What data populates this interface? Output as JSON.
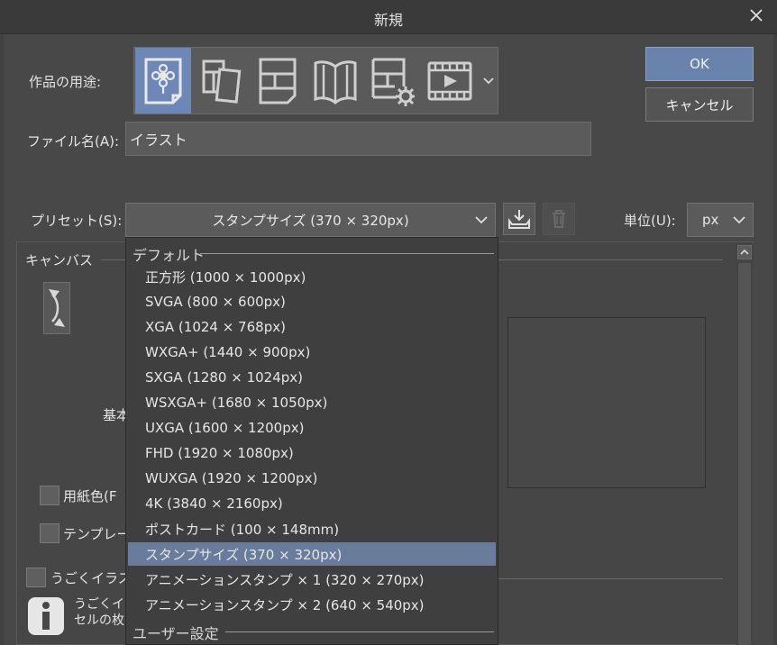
{
  "window": {
    "title": "新規"
  },
  "buttons": {
    "ok": "OK",
    "cancel": "キャンセル"
  },
  "usage": {
    "label": "作品の用途:",
    "options": [
      {
        "icon": "illustration-icon",
        "selected": true
      },
      {
        "icon": "comic-icon",
        "selected": false
      },
      {
        "icon": "comic-page-icon",
        "selected": false
      },
      {
        "icon": "book-icon",
        "selected": false
      },
      {
        "icon": "page-settings-icon",
        "selected": false
      },
      {
        "icon": "animation-icon",
        "selected": false
      }
    ]
  },
  "filename": {
    "label": "ファイル名(A):",
    "value": "イラスト"
  },
  "preset": {
    "label": "プリセット(S):",
    "value": "スタンプサイズ (370 × 320px)"
  },
  "unit": {
    "label": "単位(U):",
    "value": "px"
  },
  "canvas": {
    "section_label": "キャンバス",
    "base_label_partial": "基本",
    "paper_color_partial": "用紙色(F",
    "template_partial": "テンプレー",
    "animated_partial": "うごくイラスト",
    "info_line1_partial": "うごくイラ",
    "info_line2_partial": "セルの枚"
  },
  "dropdown": {
    "group_default": "デフォルト",
    "group_user": "ユーザー設定",
    "selected_index": 11,
    "items": [
      "正方形 (1000 × 1000px)",
      "SVGA (800 × 600px)",
      "XGA (1024 × 768px)",
      "WXGA+ (1440 × 900px)",
      "SXGA (1280 × 1024px)",
      "WSXGA+ (1680 × 1050px)",
      "UXGA (1600 × 1200px)",
      "FHD (1920 × 1080px)",
      "WUXGA (1920 × 1200px)",
      "4K (3840 × 2160px)",
      "ポストカード (100 × 148mm)",
      "スタンプサイズ (370 × 320px)",
      "アニメーションスタンプ × 1 (320 × 270px)",
      "アニメーションスタンプ × 2 (640 × 540px)"
    ]
  },
  "colors": {
    "accent": "#6a83ad",
    "selected_item": "#6a7c9c",
    "usage_selected": "#6d87b6"
  }
}
